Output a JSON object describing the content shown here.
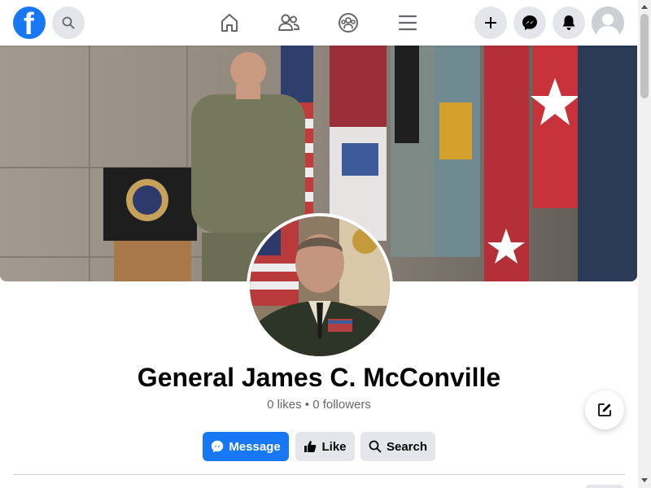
{
  "header": {
    "logo_letter": "f",
    "icons": [
      "facebook-logo",
      "search-icon",
      "home-icon",
      "friends-icon",
      "groups-icon",
      "menu-icon",
      "plus-icon",
      "messenger-icon",
      "bell-icon",
      "avatar"
    ]
  },
  "profile": {
    "name": "General James C. McConville",
    "stats": "0 likes • 0 followers"
  },
  "actions": {
    "message_label": "Message",
    "like_label": "Like",
    "search_label": "Search"
  },
  "colors": {
    "brand": "#1877f2",
    "button_gray": "#e4e6eb",
    "text_primary": "#050505",
    "text_secondary": "#65676b"
  }
}
